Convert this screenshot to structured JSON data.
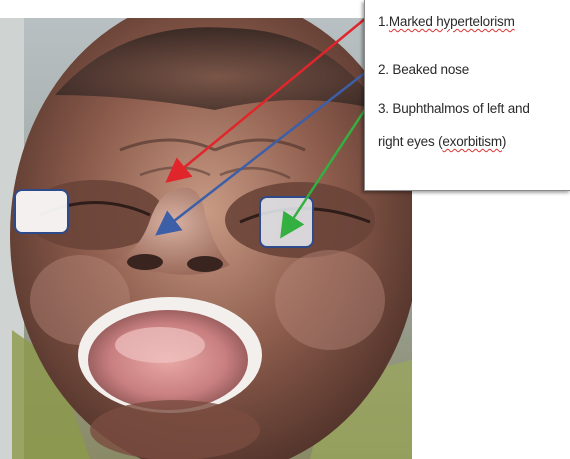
{
  "annotations": {
    "item1_prefix": "1.",
    "item1_term": "Marked hypertelorism",
    "item2": "2. Beaked nose",
    "item3_line1": "3. Buphthalmos of left and",
    "item3_line2_prefix": "right eyes (",
    "item3_line2_term": "exorbitism",
    "item3_line2_suffix": ")"
  },
  "arrows": [
    {
      "label": "hypertelorism-arrow",
      "color": "#e0262b"
    },
    {
      "label": "beaked-nose-arrow",
      "color": "#3d5fa8"
    },
    {
      "label": "buphthalmos-arrow",
      "color": "#33b040"
    }
  ],
  "markers": {
    "border_color": "#2d4a8a"
  }
}
